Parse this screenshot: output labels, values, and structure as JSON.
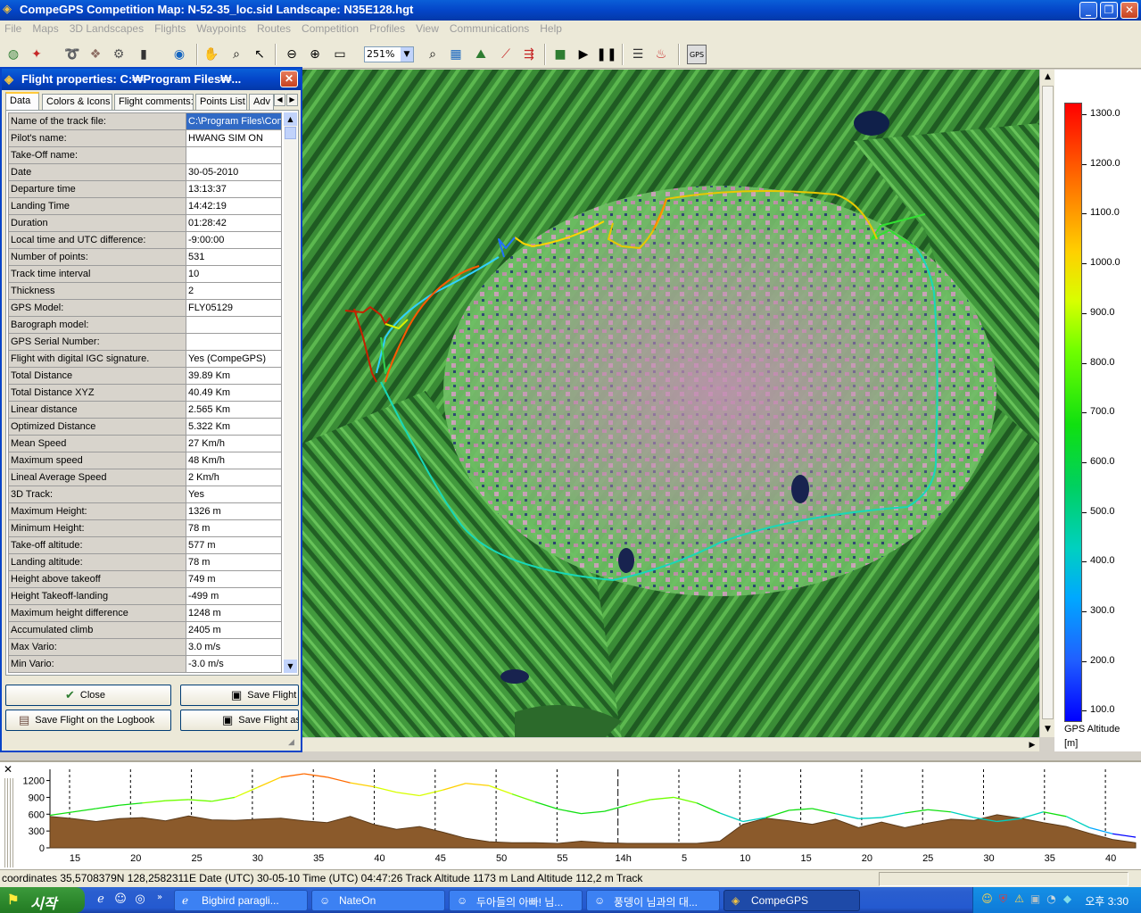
{
  "window": {
    "title": "CompeGPS Competition Map: N-52-35_loc.sid Landscape: N35E128.hgt",
    "min": "_",
    "max": "❐",
    "close": "✕"
  },
  "menu": [
    "File",
    "Maps",
    "3D Landscapes",
    "Flights",
    "Waypoints",
    "Routes",
    "Competition",
    "Profiles",
    "View",
    "Communications",
    "Help"
  ],
  "toolbar": {
    "zoom": "251%",
    "gps_label": "GPS"
  },
  "dialog": {
    "title": "Flight properties: C:₩Program Files₩...",
    "tabs": [
      "Data",
      "Colors & Icons",
      "Flight comments:",
      "Points List",
      "Adv"
    ],
    "rows": [
      {
        "k": "Name of the track file:",
        "v": "C:\\Program Files\\Con"
      },
      {
        "k": "Pilot's name:",
        "v": "HWANG SIM ON"
      },
      {
        "k": "Take-Off name:",
        "v": ""
      },
      {
        "k": "Date",
        "v": "30-05-2010"
      },
      {
        "k": "Departure time",
        "v": "13:13:37"
      },
      {
        "k": "Landing Time",
        "v": "14:42:19"
      },
      {
        "k": "Duration",
        "v": "01:28:42"
      },
      {
        "k": "Local time and UTC difference:",
        "v": "-9:00:00"
      },
      {
        "k": "Number of points:",
        "v": "531"
      },
      {
        "k": "Track time interval",
        "v": "10"
      },
      {
        "k": "Thickness",
        "v": "2"
      },
      {
        "k": "GPS Model:",
        "v": "FLY05129"
      },
      {
        "k": "Barograph model:",
        "v": ""
      },
      {
        "k": "GPS Serial Number:",
        "v": ""
      },
      {
        "k": "Flight with digital IGC signature.",
        "v": "Yes    (CompeGPS)"
      },
      {
        "k": "Total Distance",
        "v": "39.89 Km"
      },
      {
        "k": "Total Distance XYZ",
        "v": "40.49 Km"
      },
      {
        "k": "Linear distance",
        "v": "2.565 Km"
      },
      {
        "k": "Optimized Distance",
        "v": "5.322 Km"
      },
      {
        "k": "Mean Speed",
        "v": "27 Km/h"
      },
      {
        "k": "Maximum speed",
        "v": "48 Km/h"
      },
      {
        "k": "Lineal Average Speed",
        "v": "2 Km/h"
      },
      {
        "k": "3D Track:",
        "v": "Yes"
      },
      {
        "k": "Maximum Height:",
        "v": "1326 m"
      },
      {
        "k": "Minimum Height:",
        "v": "78 m"
      },
      {
        "k": "Take-off altitude:",
        "v": "577 m"
      },
      {
        "k": "Landing altitude:",
        "v": "78 m"
      },
      {
        "k": "Height above takeoff",
        "v": "749 m"
      },
      {
        "k": "Height Takeoff-landing",
        "v": "-499 m"
      },
      {
        "k": "Maximum height difference",
        "v": "1248 m"
      },
      {
        "k": "Accumulated climb",
        "v": "2405 m"
      },
      {
        "k": "Max Vario:",
        "v": "3.0 m/s"
      },
      {
        "k": "Min Vario:",
        "v": "-3.0 m/s"
      }
    ],
    "buttons": {
      "close": "Close",
      "save_flight": "Save Flight",
      "save_logbook": "Save Flight on the Logbook",
      "save_as": "Save Flight as"
    }
  },
  "legend": {
    "title": "GPS Altitude",
    "unit": "[m]",
    "ticks": [
      "1300.0",
      "1200.0",
      "1100.0",
      "1000.0",
      "900.0",
      "800.0",
      "700.0",
      "600.0",
      "500.0",
      "400.0",
      "300.0",
      "200.0",
      "100.0"
    ]
  },
  "chart_data": {
    "type": "area",
    "title": "",
    "ylabel": "",
    "ylim": [
      0,
      1400
    ],
    "yticks": [
      "1200",
      "900",
      "600",
      "300",
      "0"
    ],
    "xticks": [
      "15",
      "20",
      "25",
      "30",
      "35",
      "40",
      "45",
      "50",
      "55",
      "14h",
      "5",
      "10",
      "15",
      "20",
      "25",
      "30",
      "35",
      "40"
    ],
    "series": [
      {
        "values": [
          580,
          640,
          700,
          760,
          800,
          840,
          860,
          830,
          900,
          1080,
          1260,
          1320,
          1260,
          1160,
          1090,
          990,
          930,
          1030,
          1150,
          1110,
          960,
          820,
          690,
          610,
          650,
          760,
          860,
          900,
          800,
          620,
          470,
          540,
          670,
          700,
          610,
          520,
          540,
          620,
          680,
          640,
          540,
          470,
          520,
          640,
          560,
          360,
          250,
          190
        ]
      },
      {
        "values": [
          560,
          520,
          470,
          520,
          540,
          480,
          570,
          500,
          490,
          510,
          530,
          480,
          450,
          560,
          420,
          330,
          380,
          280,
          170,
          110,
          90,
          90,
          80,
          120,
          90,
          80,
          80,
          80,
          80,
          120,
          420,
          530,
          480,
          420,
          510,
          360,
          460,
          360,
          440,
          510,
          490,
          590,
          530,
          450,
          380,
          260,
          150,
          90
        ]
      }
    ]
  },
  "status": "coordinates 35,5708379N 128,2582311E Date (UTC) 30-05-10 Time (UTC) 04:47:26 Track Altitude 1173 m Land Altitude 112,2 m Track",
  "taskbar": {
    "start": "시작",
    "items": [
      "Bigbird paragli...",
      "NateOn",
      "두아들의 아빠! 님...",
      "풍뎅이 님과의 대...",
      "CompeGPS"
    ],
    "clock": "오후 3:30"
  }
}
